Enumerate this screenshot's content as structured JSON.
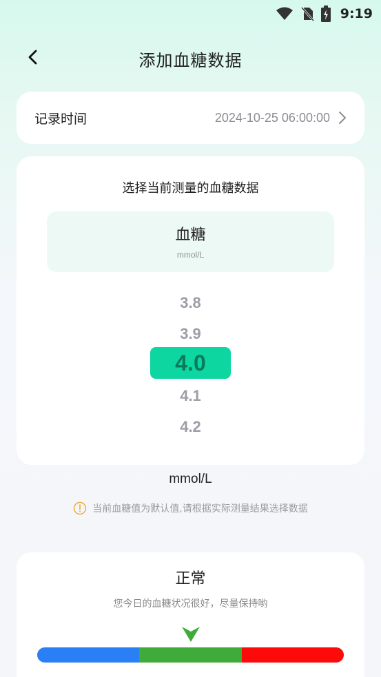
{
  "status_bar": {
    "time": "9:19",
    "icons": [
      "wifi-icon",
      "no-sim-icon",
      "battery-charging-icon"
    ]
  },
  "header": {
    "title": "添加血糖数据",
    "back_icon": "chevron-left-icon"
  },
  "record_time": {
    "label": "记录时间",
    "value": "2024-10-25 06:00:00",
    "icon": "chevron-right-icon"
  },
  "picker": {
    "prompt": "选择当前测量的血糖数据",
    "metric_name": "血糖",
    "metric_unit": "mmol/L",
    "options": [
      "3.8",
      "3.9",
      "4.0",
      "4.1",
      "4.2"
    ],
    "selected": "4.0",
    "selected_color": "#0dd6a0"
  },
  "unit_caption": "mmol/L",
  "notice": {
    "icon": "info-circle-icon",
    "text": "当前血糖值为默认值,请根据实际测量结果选择数据"
  },
  "result": {
    "title": "正常",
    "description": "您今日的血糖状况很好，尽量保持哟",
    "pointer_icon": "arrow-down-pointer-icon",
    "pointer_color": "#3fab3a",
    "segments": [
      {
        "color": "#2b7ff5"
      },
      {
        "color": "#3fab3a"
      },
      {
        "color": "#ff0a0a"
      }
    ]
  }
}
